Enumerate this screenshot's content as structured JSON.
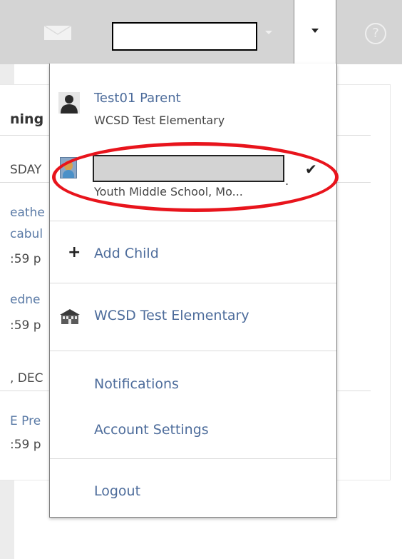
{
  "topbar": {
    "mail_icon": "envelope-icon",
    "menu_caret_icon": "caret-down-icon",
    "help_icon_glyph": "?",
    "colors": {
      "bar": "#d4d4d4",
      "link": "#4d6c9b",
      "highlight": "#e8141c"
    }
  },
  "background": {
    "heading": "ning",
    "day1": "SDAY",
    "item1_line1": "eathe",
    "item1_line2": "cabul",
    "item1_time": ":59 p",
    "item2_line1": "edne",
    "item2_time": ":59 p",
    "day2": ", DEC",
    "item3_line1": "E Pre",
    "item3_time": ":59 p"
  },
  "menu": {
    "profile": {
      "name": "Test01 Parent",
      "school": "WCSD Test Elementary",
      "icon": "person-icon"
    },
    "student": {
      "school": "Youth Middle School, Mo...",
      "icon": "student-photo-icon",
      "check_icon": "checkmark-icon",
      "trailing": "."
    },
    "add_child": {
      "label": "Add Child",
      "icon": "plus-icon"
    },
    "school": {
      "label": "WCSD Test Elementary",
      "icon": "school-building-icon"
    },
    "notifications": "Notifications",
    "account_settings": "Account Settings",
    "logout": "Logout"
  }
}
